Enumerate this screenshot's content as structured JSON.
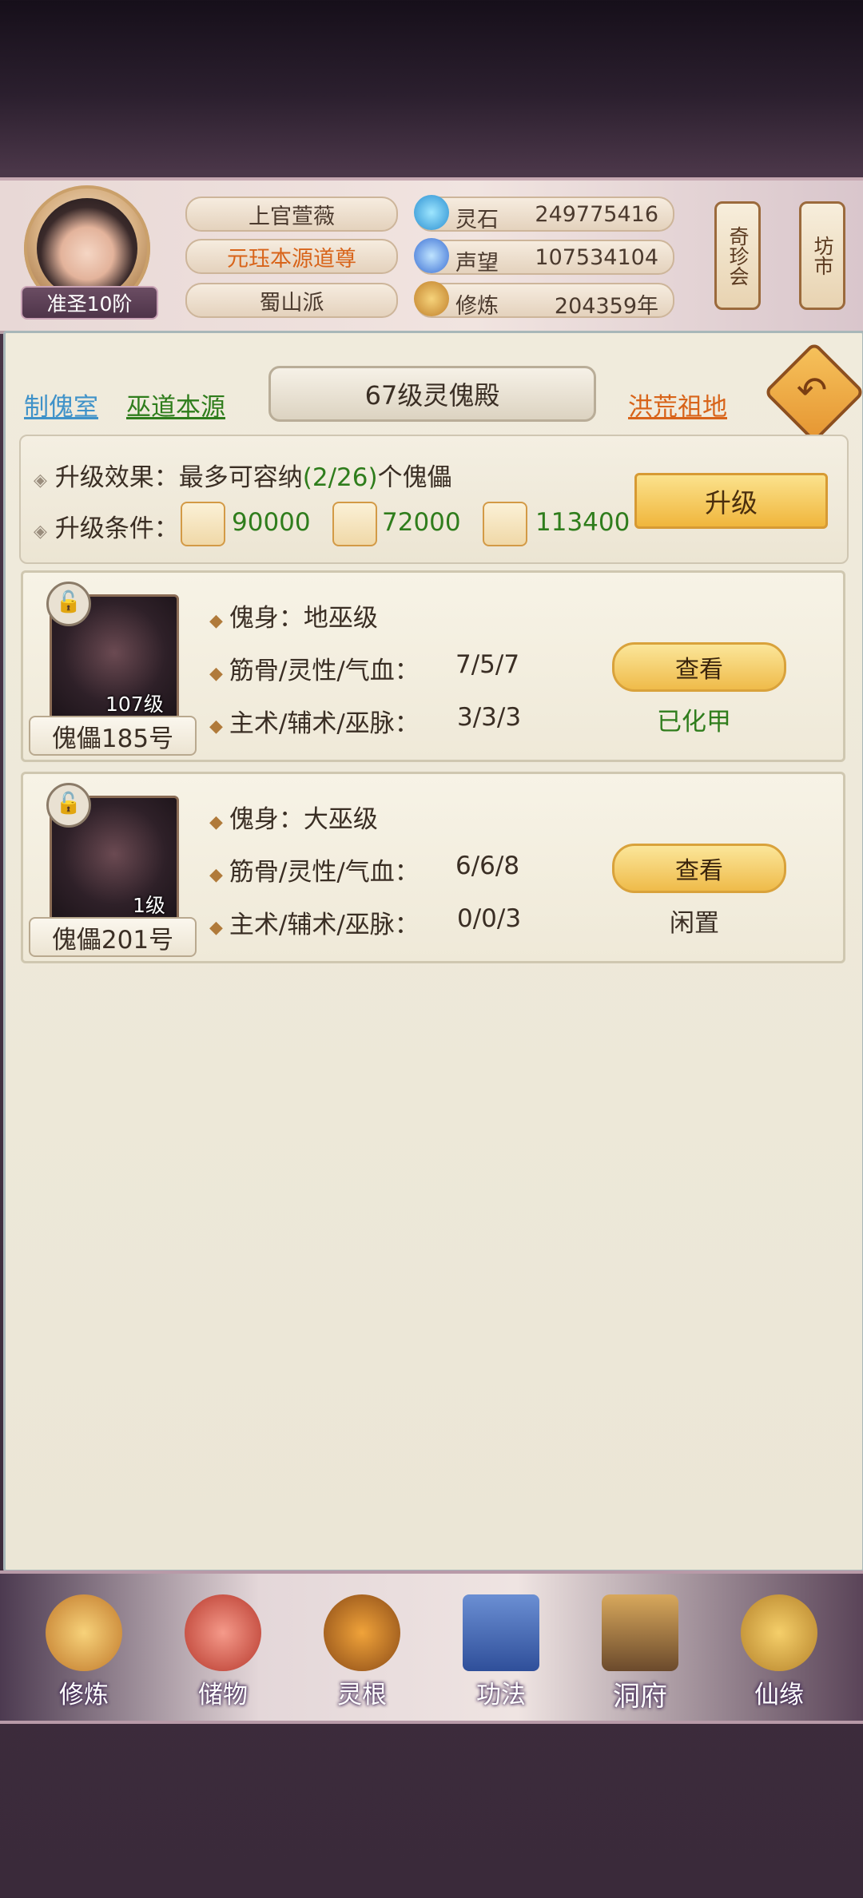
{
  "header": {
    "rank": "准圣10阶",
    "name": "上官萱薇",
    "title": "元珏本源道尊",
    "sect": "蜀山派",
    "stats": [
      {
        "label": "灵石",
        "value": "249775416",
        "icon": "spirit-stone-icon"
      },
      {
        "label": "声望",
        "value": "107534104",
        "icon": "prestige-icon"
      },
      {
        "label": "修炼",
        "value": "204359年",
        "icon": "cultivation-icon"
      }
    ],
    "side_buttons": [
      "奇珍会",
      "坊市"
    ]
  },
  "nav": {
    "left1": "制傀室",
    "left2": "巫道本源",
    "title": "67级灵傀殿",
    "right": "洪荒祖地"
  },
  "upgrade": {
    "effect_label": "升级效果：",
    "effect_pre": "最多可容纳",
    "effect_count": "(2/26)",
    "effect_post": "个傀儡",
    "cond_label": "升级条件：",
    "materials": [
      {
        "icon": "ore-icon",
        "amount": "90000"
      },
      {
        "icon": "wood-icon",
        "amount": "72000"
      },
      {
        "icon": "herb-icon",
        "amount": "113400"
      }
    ],
    "button": "升级"
  },
  "puppets": [
    {
      "level": "107级",
      "name": "傀儡185号",
      "body": "傀身：地巫级",
      "attr_label": "筋骨/灵性/气血：",
      "attr_value": "7/5/7",
      "skill_label": "主术/辅术/巫脉：",
      "skill_value": "3/3/3",
      "button": "查看",
      "status": "已化甲",
      "status_color": "#2f7d1c"
    },
    {
      "level": "1级",
      "name": "傀儡201号",
      "body": "傀身：大巫级",
      "attr_label": "筋骨/灵性/气血：",
      "attr_value": "6/6/8",
      "skill_label": "主术/辅术/巫脉：",
      "skill_value": "0/0/3",
      "button": "查看",
      "status": "闲置",
      "status_color": "#3a2e24"
    }
  ],
  "bottom_nav": [
    {
      "label": "修炼",
      "icon": "meditating-figure-icon"
    },
    {
      "label": "储物",
      "icon": "storage-bag-icon"
    },
    {
      "label": "灵根",
      "icon": "spirit-root-icon"
    },
    {
      "label": "功法",
      "icon": "scripture-book-icon"
    },
    {
      "label": "洞府",
      "icon": "cave-dwelling-icon"
    },
    {
      "label": "仙缘",
      "icon": "gourd-icon"
    }
  ]
}
